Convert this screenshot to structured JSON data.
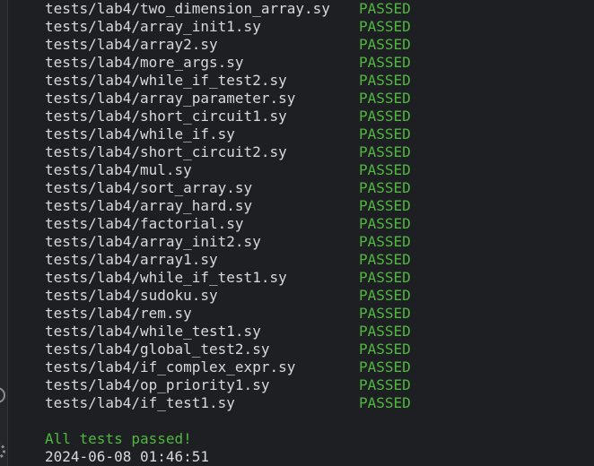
{
  "terminal": {
    "results": [
      {
        "path": "tests/lab4/two_dimension_array.sy",
        "status": "PASSED"
      },
      {
        "path": "tests/lab4/array_init1.sy",
        "status": "PASSED"
      },
      {
        "path": "tests/lab4/array2.sy",
        "status": "PASSED"
      },
      {
        "path": "tests/lab4/more_args.sy",
        "status": "PASSED"
      },
      {
        "path": "tests/lab4/while_if_test2.sy",
        "status": "PASSED"
      },
      {
        "path": "tests/lab4/array_parameter.sy",
        "status": "PASSED"
      },
      {
        "path": "tests/lab4/short_circuit1.sy",
        "status": "PASSED"
      },
      {
        "path": "tests/lab4/while_if.sy",
        "status": "PASSED"
      },
      {
        "path": "tests/lab4/short_circuit2.sy",
        "status": "PASSED"
      },
      {
        "path": "tests/lab4/mul.sy",
        "status": "PASSED"
      },
      {
        "path": "tests/lab4/sort_array.sy",
        "status": "PASSED"
      },
      {
        "path": "tests/lab4/array_hard.sy",
        "status": "PASSED"
      },
      {
        "path": "tests/lab4/factorial.sy",
        "status": "PASSED"
      },
      {
        "path": "tests/lab4/array_init2.sy",
        "status": "PASSED"
      },
      {
        "path": "tests/lab4/array1.sy",
        "status": "PASSED"
      },
      {
        "path": "tests/lab4/while_if_test1.sy",
        "status": "PASSED"
      },
      {
        "path": "tests/lab4/sudoku.sy",
        "status": "PASSED"
      },
      {
        "path": "tests/lab4/rem.sy",
        "status": "PASSED"
      },
      {
        "path": "tests/lab4/while_test1.sy",
        "status": "PASSED"
      },
      {
        "path": "tests/lab4/global_test2.sy",
        "status": "PASSED"
      },
      {
        "path": "tests/lab4/if_complex_expr.sy",
        "status": "PASSED"
      },
      {
        "path": "tests/lab4/op_priority1.sy",
        "status": "PASSED"
      },
      {
        "path": "tests/lab4/if_test1.sy",
        "status": "PASSED"
      }
    ],
    "summary": "All tests passed!",
    "timestamp": "2024-06-08 01:46:51"
  },
  "sidebar": {
    "icons": [
      "history-icon",
      "gear-icon"
    ]
  },
  "colors": {
    "background": "#1e1f22",
    "text": "#d7d9dc",
    "passed": "#4fb83f"
  }
}
